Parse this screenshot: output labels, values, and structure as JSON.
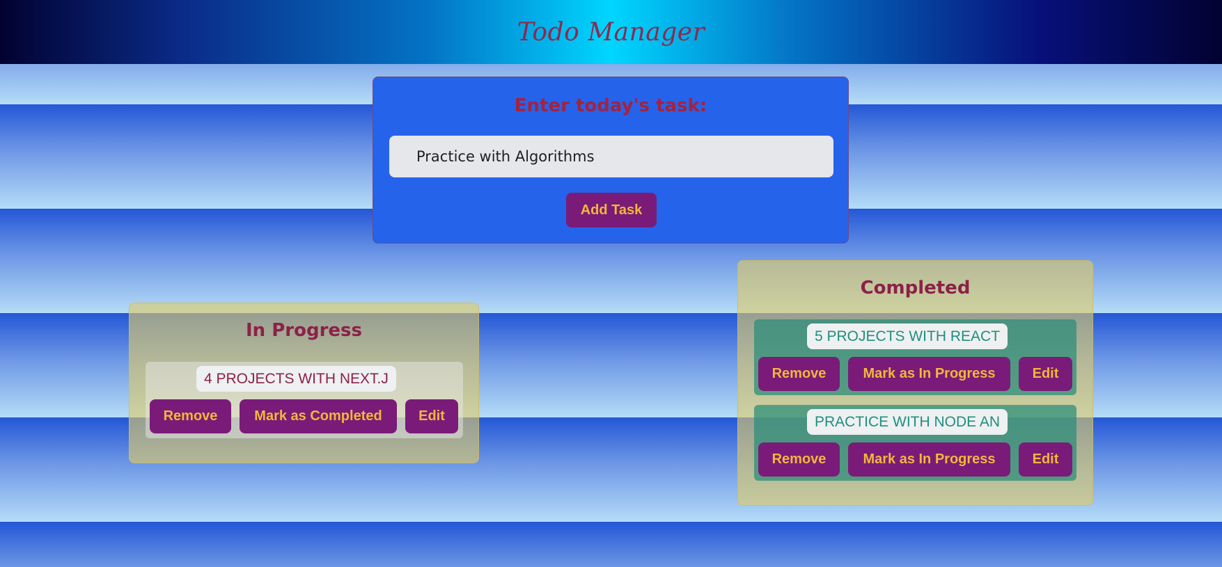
{
  "header": {
    "title": "Todo Manager"
  },
  "input_section": {
    "heading": "Enter today's task:",
    "input_value": "Practice with Algorithms",
    "add_button_label": "Add Task"
  },
  "in_progress": {
    "title": "In Progress",
    "tasks": [
      {
        "name": "4 PROJECTS WITH NEXT.J",
        "remove_label": "Remove",
        "move_label": "Mark as Completed",
        "edit_label": "Edit"
      }
    ]
  },
  "completed": {
    "title": "Completed",
    "tasks": [
      {
        "name": "5 PROJECTS WITH REACT",
        "remove_label": "Remove",
        "move_label": "Mark as In Progress",
        "edit_label": "Edit"
      },
      {
        "name": "PRACTICE WITH NODE AN",
        "remove_label": "Remove",
        "move_label": "Mark as In Progress",
        "edit_label": "Edit"
      }
    ]
  },
  "colors": {
    "header_title": "#8d2a4e",
    "card_blue": "#2563eb",
    "button_bg": "#7a1b79",
    "button_text": "#f4b63a",
    "column_bg": "#decc68",
    "completed_task_bg": "#288c78"
  }
}
